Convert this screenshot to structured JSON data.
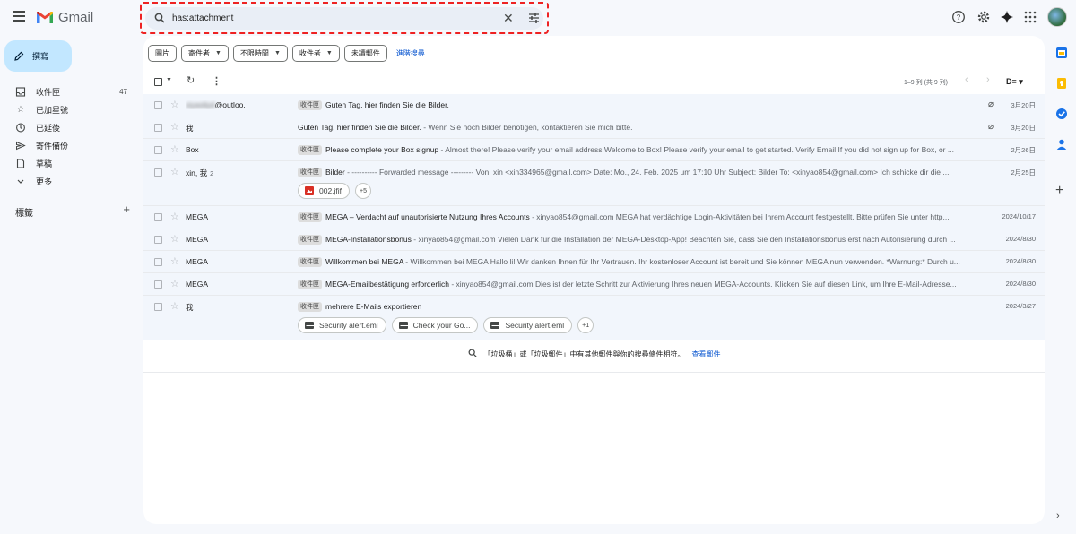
{
  "header": {
    "app_name": "Gmail",
    "search_value": "has:attachment"
  },
  "compose_label": "撰寫",
  "sidebar": {
    "items": [
      {
        "label": "收件匣",
        "icon": "inbox-icon",
        "count": "47"
      },
      {
        "label": "已加星號",
        "icon": "star-icon",
        "count": ""
      },
      {
        "label": "已延後",
        "icon": "clock-icon",
        "count": ""
      },
      {
        "label": "寄件備份",
        "icon": "send-icon",
        "count": ""
      },
      {
        "label": "草稿",
        "icon": "draft-icon",
        "count": ""
      },
      {
        "label": "更多",
        "icon": "chevron-down-icon",
        "count": ""
      }
    ],
    "labels_title": "標籤"
  },
  "filters": {
    "chips": [
      {
        "label": "圖片",
        "dropdown": false
      },
      {
        "label": "寄件者",
        "dropdown": true
      },
      {
        "label": "不限時間",
        "dropdown": true
      },
      {
        "label": "收件者",
        "dropdown": true
      },
      {
        "label": "未讀郵件",
        "dropdown": false
      }
    ],
    "advanced": "進階搜尋"
  },
  "toolbar": {
    "range": "1–9 列 (共 9 列)"
  },
  "emails": [
    {
      "sender": "xiyaoliyd",
      "sender_suffix": "@outloo.",
      "count": "",
      "tag": "收件匣",
      "subject": "Guten Tag, hier finden Sie die Bilder.",
      "snippet": "",
      "clip": true,
      "date": "3月20日",
      "attachments": [],
      "more": ""
    },
    {
      "sender": "我",
      "sender_suffix": "",
      "count": "",
      "tag": "",
      "subject": "Guten Tag, hier finden Sie die Bilder.",
      "snippet": " - Wenn Sie noch Bilder benötigen, kontaktieren Sie mich bitte.",
      "clip": true,
      "date": "3月20日",
      "attachments": [],
      "more": ""
    },
    {
      "sender": "Box",
      "sender_suffix": "",
      "count": "",
      "tag": "收件匣",
      "subject": "Please complete your Box signup",
      "snippet": " - Almost there! Please verify your email address Welcome to Box! Please verify your email to get started. Verify Email If you did not sign up for Box, or ...",
      "clip": false,
      "date": "2月26日",
      "attachments": [],
      "more": ""
    },
    {
      "sender": "xin, 我",
      "sender_suffix": "",
      "count": "2",
      "tag": "收件匣",
      "subject": "Bilder",
      "snippet": " - ---------- Forwarded message --------- Von: xin <xin334965@gmail.com> Date: Mo., 24. Feb. 2025 um 17:10 Uhr Subject: Bilder To: <xinyao854@gmail.com> Ich schicke dir die ...",
      "clip": false,
      "date": "2月25日",
      "attachments": [
        {
          "name": "002.jfif",
          "kind": "image"
        }
      ],
      "more": "+5"
    },
    {
      "sender": "MEGA",
      "sender_suffix": "",
      "count": "",
      "tag": "收件匣",
      "subject": "MEGA – Verdacht auf unautorisierte Nutzung Ihres Accounts",
      "snippet": " - xinyao854@gmail.com MEGA hat verdächtige Login-Aktivitäten bei Ihrem Account festgestellt. Bitte prüfen Sie unter http...",
      "clip": false,
      "date": "2024/10/17",
      "attachments": [],
      "more": ""
    },
    {
      "sender": "MEGA",
      "sender_suffix": "",
      "count": "",
      "tag": "收件匣",
      "subject": "MEGA-Installationsbonus",
      "snippet": " - xinyao854@gmail.com Vielen Dank für die Installation der MEGA-Desktop-App! Beachten Sie, dass Sie den Installationsbonus erst nach Autorisierung durch ...",
      "clip": false,
      "date": "2024/8/30",
      "attachments": [],
      "more": ""
    },
    {
      "sender": "MEGA",
      "sender_suffix": "",
      "count": "",
      "tag": "收件匣",
      "subject": "Willkommen bei MEGA",
      "snippet": " - Willkommen bei MEGA Hallo li! Wir danken Ihnen für Ihr Vertrauen. Ihr kostenloser Account ist bereit und Sie können MEGA nun verwenden. *Warnung:* Durch u...",
      "clip": false,
      "date": "2024/8/30",
      "attachments": [],
      "more": ""
    },
    {
      "sender": "MEGA",
      "sender_suffix": "",
      "count": "",
      "tag": "收件匣",
      "subject": "MEGA-Emailbestätigung erforderlich",
      "snippet": " - xinyao854@gmail.com Dies ist der letzte Schritt zur Aktivierung Ihres neuen MEGA-Accounts. Klicken Sie auf diesen Link, um Ihre E-Mail-Adresse...",
      "clip": false,
      "date": "2024/8/30",
      "attachments": [],
      "more": ""
    },
    {
      "sender": "我",
      "sender_suffix": "",
      "count": "",
      "tag": "收件匣",
      "subject": "mehrere E-Mails exportieren",
      "snippet": "",
      "clip": false,
      "date": "2024/3/27",
      "attachments": [
        {
          "name": "Security alert.eml",
          "kind": "mail"
        },
        {
          "name": "Check your Go...",
          "kind": "mail"
        },
        {
          "name": "Security alert.eml",
          "kind": "mail"
        }
      ],
      "more": "+1"
    }
  ],
  "footer": {
    "note": "「垃圾桶」或「垃圾郵件」中有其他郵件與你的搜尋條件相符。",
    "link": "查看郵件"
  },
  "colors": {
    "accent": "#0b57d0",
    "compose_bg": "#c2e7ff",
    "highlight_border": "#ee2222"
  }
}
